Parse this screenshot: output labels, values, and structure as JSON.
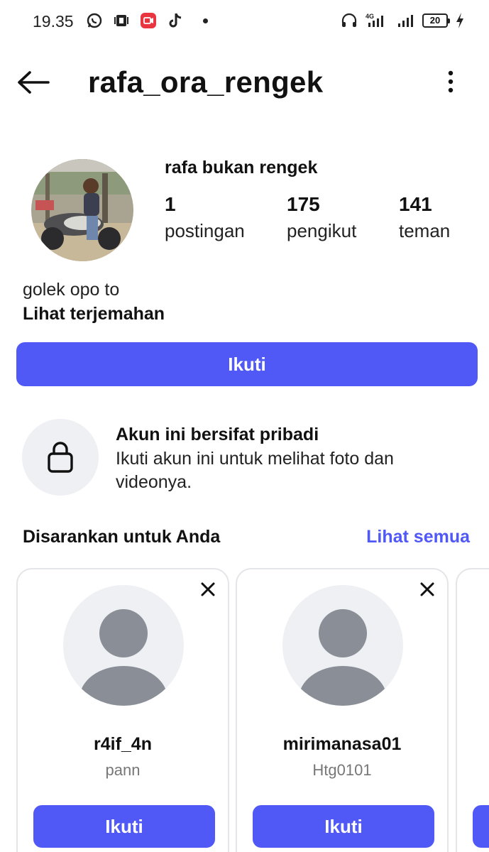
{
  "status_bar": {
    "time": "19.35",
    "network": "4G",
    "battery": "20"
  },
  "header": {
    "username": "rafa_ora_rengek"
  },
  "profile": {
    "display_name": "rafa bukan rengek",
    "stats": [
      {
        "value": "1",
        "label": "postingan"
      },
      {
        "value": "175",
        "label": "pengikut"
      },
      {
        "value": "141",
        "label": "teman"
      }
    ],
    "bio": "golek opo to",
    "translate_label": "Lihat terjemahan",
    "follow_label": "Ikuti"
  },
  "private_notice": {
    "title": "Akun ini bersifat pribadi",
    "description": "Ikuti akun ini untuk melihat foto dan videonya."
  },
  "suggestions": {
    "title": "Disarankan untuk Anda",
    "see_all": "Lihat semua",
    "cards": [
      {
        "username": "r4if_4n",
        "name": "pann",
        "follow_label": "Ikuti"
      },
      {
        "username": "mirimanasa01",
        "name": "Htg0101",
        "follow_label": "Ikuti"
      }
    ]
  },
  "colors": {
    "accent": "#5058f6",
    "placeholder_bg": "#eef0f3",
    "placeholder_fg": "#8a8e97"
  },
  "icons": [
    "whatsapp-icon",
    "media-icon",
    "screen-record-icon",
    "tiktok-icon",
    "headset-icon",
    "signal-icon",
    "battery-icon",
    "back-arrow-icon",
    "more-vertical-icon",
    "lock-icon",
    "close-icon",
    "default-avatar-icon"
  ]
}
